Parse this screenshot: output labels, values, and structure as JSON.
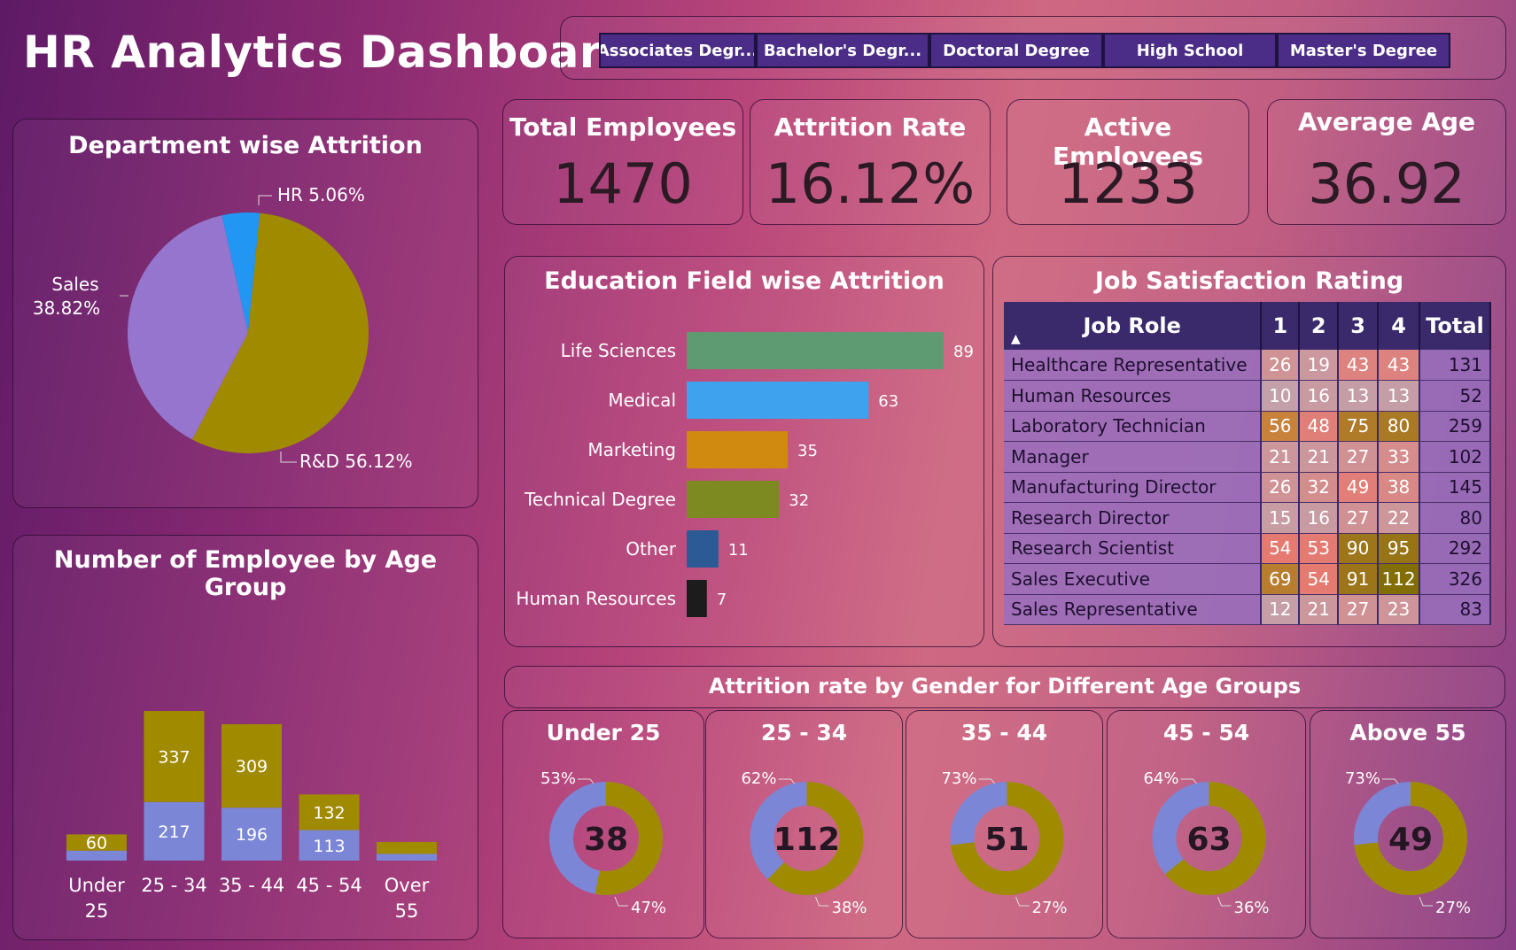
{
  "title": "HR Analytics Dashboard",
  "slicer": [
    "Associates Degr...",
    "Bachelor's Degr...",
    "Doctoral Degree",
    "High School",
    "Master's Degree"
  ],
  "kpis": [
    {
      "label": "Total Employees",
      "value": "1470"
    },
    {
      "label": "Attrition Rate",
      "value": "16.12%"
    },
    {
      "label": "Active Employees",
      "value": "1233"
    },
    {
      "label": "Average Age",
      "value": "36.92"
    }
  ],
  "colors": {
    "olive": "#a08a00",
    "lavender": "#9575cd",
    "blue": "#2196f3",
    "periwinkle": "#7b86d6"
  },
  "chart_data": [
    {
      "type": "pie",
      "title": "Department wise Attrition",
      "slices": [
        {
          "label": "R&D",
          "value": 56.12,
          "display": "R&D 56.12%",
          "color": "#a08a00"
        },
        {
          "label": "Sales",
          "value": 38.82,
          "display": "Sales\n38.82%",
          "color": "#9575cd"
        },
        {
          "label": "HR",
          "value": 5.06,
          "display": "HR 5.06%",
          "color": "#2196f3"
        }
      ]
    },
    {
      "type": "bar",
      "title": "Education Field wise Attrition",
      "orientation": "horizontal",
      "categories": [
        "Life Sciences",
        "Medical",
        "Marketing",
        "Technical Degree",
        "Other",
        "Human Resources"
      ],
      "values": [
        89,
        63,
        35,
        32,
        11,
        7
      ],
      "colors": [
        "#5e9a72",
        "#3ea2ee",
        "#d08a10",
        "#7d8a22",
        "#2c5a94",
        "#1c1c1c"
      ]
    },
    {
      "type": "bar",
      "title": "Number of Employee by Age Group",
      "stacked": true,
      "categories": [
        "Under 25",
        "25 - 34",
        "35 - 44",
        "45 - 54",
        "Over 55"
      ],
      "category_labels": [
        [
          "Under",
          "25"
        ],
        [
          "25 - 34"
        ],
        [
          "35 - 44"
        ],
        [
          "45 - 54"
        ],
        [
          "Over",
          "55"
        ]
      ],
      "series": [
        {
          "values": [
            37,
            217,
            196,
            113,
            25
          ],
          "labels": [
            "",
            "217",
            "196",
            "113",
            ""
          ],
          "color": "#7b86d6"
        },
        {
          "values": [
            60,
            337,
            309,
            132,
            44
          ],
          "labels": [
            "60",
            "337",
            "309",
            "132",
            ""
          ],
          "color": "#a08a00"
        }
      ]
    },
    {
      "type": "table",
      "title": "Job Satisfaction Rating",
      "columns": [
        "Job Role",
        "1",
        "2",
        "3",
        "4",
        "Total"
      ],
      "rows": [
        [
          "Healthcare Representative",
          26,
          19,
          43,
          43,
          131
        ],
        [
          "Human Resources",
          10,
          16,
          13,
          13,
          52
        ],
        [
          "Laboratory Technician",
          56,
          48,
          75,
          80,
          259
        ],
        [
          "Manager",
          21,
          21,
          27,
          33,
          102
        ],
        [
          "Manufacturing Director",
          26,
          32,
          49,
          38,
          145
        ],
        [
          "Research Director",
          15,
          16,
          27,
          22,
          80
        ],
        [
          "Research Scientist",
          54,
          53,
          90,
          95,
          292
        ],
        [
          "Sales Executive",
          69,
          54,
          91,
          112,
          326
        ],
        [
          "Sales Representative",
          12,
          21,
          27,
          23,
          83
        ]
      ]
    },
    {
      "type": "pie",
      "title": "Attrition rate by Gender for Different Age Groups",
      "donuts": [
        {
          "label": "Under 25",
          "center": "38",
          "olive": 53,
          "blue": 47
        },
        {
          "label": "25 - 34",
          "center": "112",
          "olive": 62,
          "blue": 38
        },
        {
          "label": "35 - 44",
          "center": "51",
          "olive": 73,
          "blue": 27
        },
        {
          "label": "45 - 54",
          "center": "63",
          "olive": 64,
          "blue": 36
        },
        {
          "label": "Above 55",
          "center": "49",
          "olive": 73,
          "blue": 27
        }
      ]
    }
  ]
}
